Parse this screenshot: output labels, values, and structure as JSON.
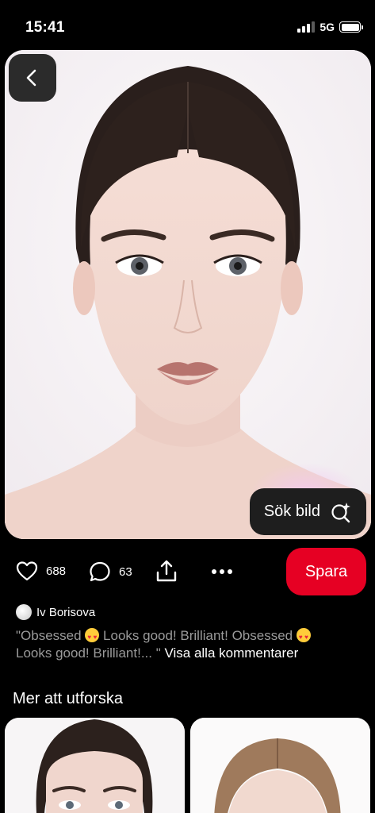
{
  "status_bar": {
    "time": "15:41",
    "network": "5G"
  },
  "pin": {
    "search_image_label": "Sök bild",
    "likes_count": "688",
    "comments_count": "63",
    "save_label": "Spara",
    "author_name": "Iv Borisova",
    "comment_part1": "\"Obsessed ",
    "comment_part2": " Looks good! Brilliant! Obsessed ",
    "comment_part3": " Looks good! Brilliant!... \" ",
    "view_all_comments": "Visa alla kommentarer"
  },
  "explore": {
    "title": "Mer att utforska"
  },
  "colors": {
    "accent": "#e60023",
    "background": "#000000",
    "muted_text": "#9a9a9a"
  },
  "icons": [
    "back-icon",
    "visual-search-icon",
    "heart-icon",
    "comment-icon",
    "share-icon",
    "more-icon"
  ]
}
